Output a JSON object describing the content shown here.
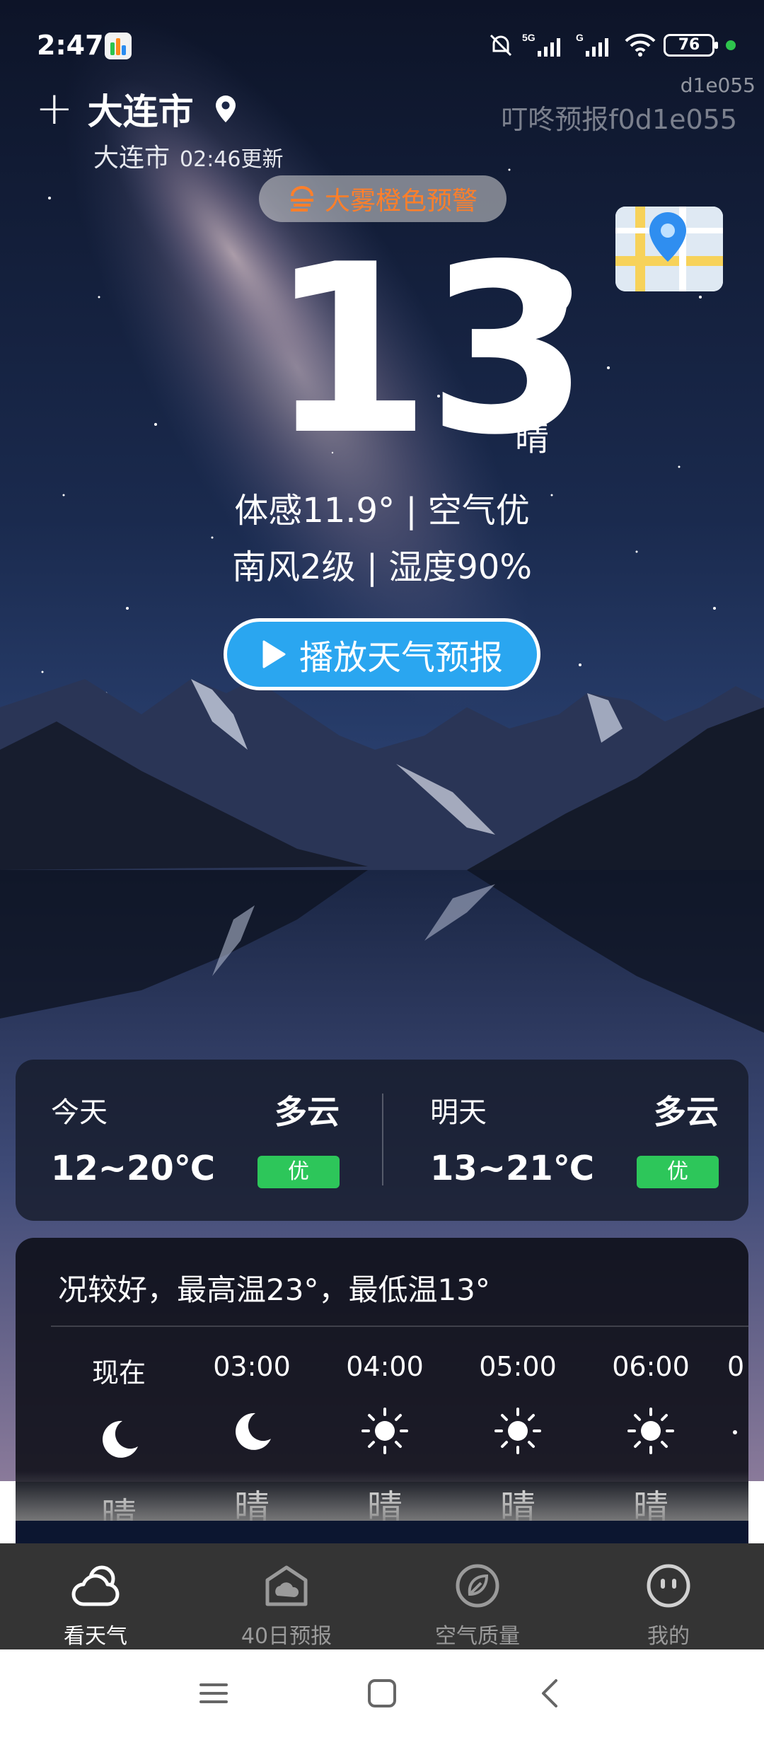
{
  "status_bar": {
    "time": "2:47",
    "battery": "76",
    "icons": [
      "muted-bell-icon",
      "5g-signal-icon",
      "g-signal-icon",
      "wifi-icon",
      "battery-icon"
    ]
  },
  "header": {
    "city": "大连市",
    "sub_city": "大连市",
    "updated": "02:46更新",
    "watermark_small": "d1e055",
    "watermark_large": "叮咚预报f0d1e055"
  },
  "alert": {
    "label": "大雾橙色预警",
    "color": "#ff7f2a"
  },
  "current": {
    "temp": "13",
    "condition": "晴",
    "feels_line": "体感11.9° | 空气优",
    "wind_line": "南风2级 | 湿度90%"
  },
  "play_button": {
    "label": "播放天气预报"
  },
  "forecast": [
    {
      "day": "今天",
      "condition": "多云",
      "range": "12~20℃",
      "air": "优"
    },
    {
      "day": "明天",
      "condition": "多云",
      "range": "13~21℃",
      "air": "优"
    }
  ],
  "hourly": {
    "summary": "况较好，最高温23°，最低温13°",
    "items": [
      {
        "time": "现在",
        "icon": "moon-icon",
        "condition": "晴"
      },
      {
        "time": "03:00",
        "icon": "moon-icon",
        "condition": "晴"
      },
      {
        "time": "04:00",
        "icon": "sun-icon",
        "condition": "晴"
      },
      {
        "time": "05:00",
        "icon": "sun-icon",
        "condition": "晴"
      },
      {
        "time": "06:00",
        "icon": "sun-icon",
        "condition": "晴"
      },
      {
        "time": "0",
        "icon": "sun-icon",
        "condition": ""
      }
    ]
  },
  "nav": [
    {
      "label": "看天气",
      "icon": "cloud-icon",
      "active": true
    },
    {
      "label": "40日预报",
      "icon": "calendar-icon",
      "active": false
    },
    {
      "label": "空气质量",
      "icon": "leaf-icon",
      "active": false
    },
    {
      "label": "我的",
      "icon": "face-icon",
      "active": false
    }
  ],
  "colors": {
    "accent_blue": "#2aa6f0",
    "air_good": "#2dc65a",
    "nav_bg": "#343434"
  }
}
